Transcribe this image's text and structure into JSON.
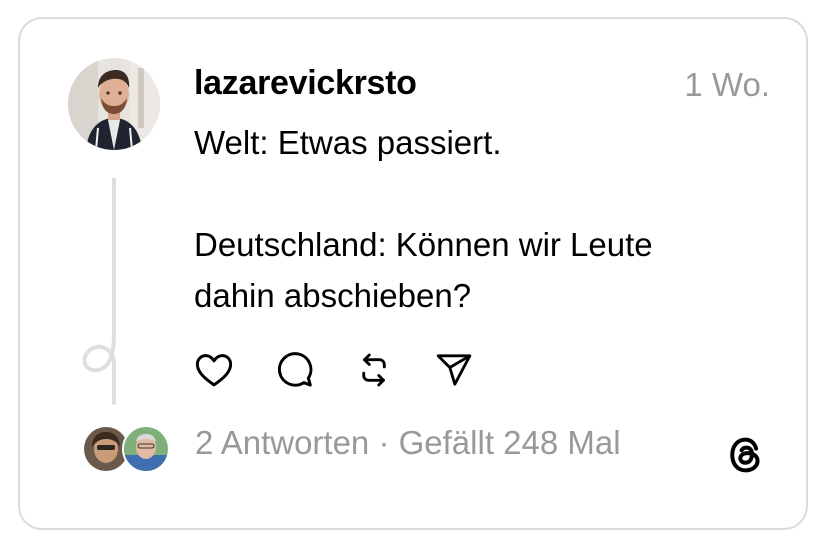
{
  "post": {
    "username": "lazarevickrsto",
    "time": "1 Wo.",
    "text_line1": "Welt: Etwas passiert.",
    "text_line2": "Deutschland: Können wir Leute",
    "text_line3": "dahin abschieben?"
  },
  "actions": {
    "like_icon": "heart-icon",
    "reply_icon": "comment-icon",
    "repost_icon": "repost-icon",
    "share_icon": "send-icon"
  },
  "footer": {
    "replies": "2 Antworten",
    "separator": " · ",
    "likes": "Gefällt 248 Mal",
    "logo_icon": "threads-logo-icon"
  },
  "colors": {
    "text": "#000000",
    "muted": "#999999",
    "border": "#dbdbdb"
  }
}
